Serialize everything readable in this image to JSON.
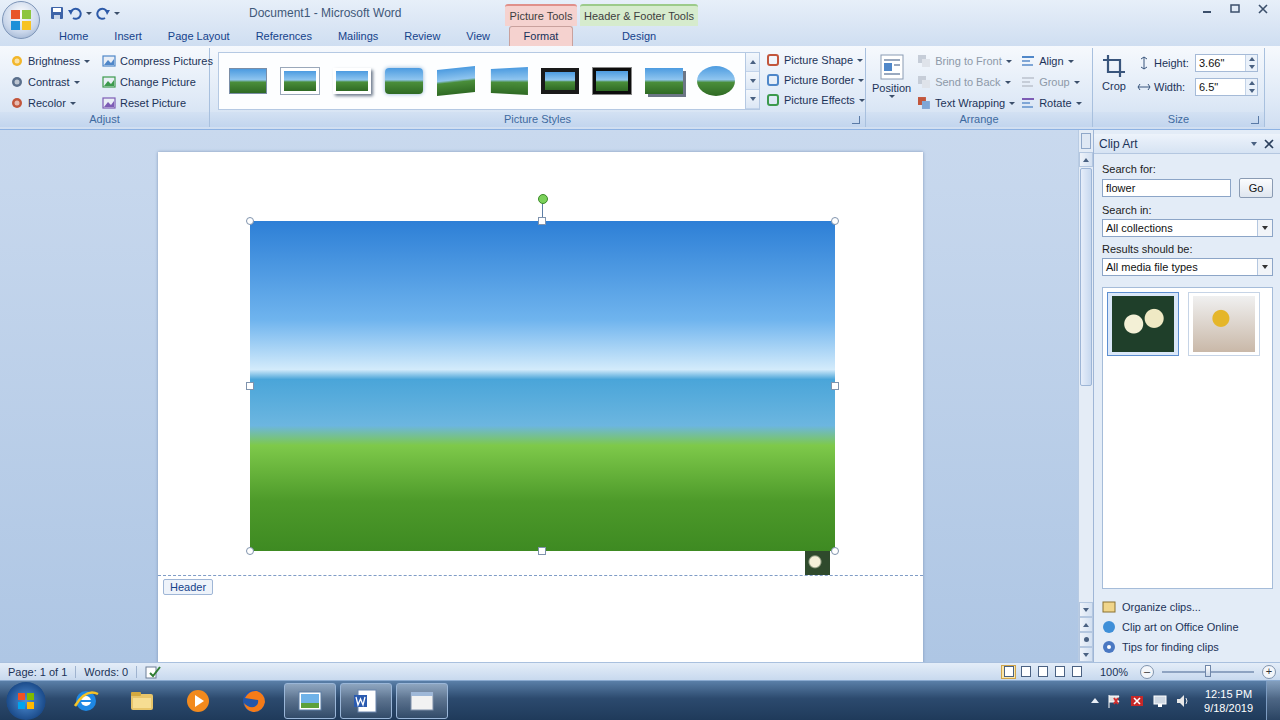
{
  "window": {
    "title": "Document1 - Microsoft Word"
  },
  "tabs": [
    {
      "label": "Home",
      "selected": false
    },
    {
      "label": "Insert",
      "selected": false
    },
    {
      "label": "Page Layout",
      "selected": false
    },
    {
      "label": "References",
      "selected": false
    },
    {
      "label": "Mailings",
      "selected": false
    },
    {
      "label": "Review",
      "selected": false
    },
    {
      "label": "View",
      "selected": false
    }
  ],
  "contextual_tabs": [
    {
      "label": "Picture Tools",
      "color": "#f5d2cf",
      "tabs": [
        {
          "label": "Format",
          "selected": true
        }
      ]
    },
    {
      "label": "Header & Footer Tools",
      "color": "#d6ebcd",
      "tabs": [
        {
          "label": "Design",
          "selected": false
        }
      ]
    }
  ],
  "ribbon": {
    "adjust": {
      "label": "Adjust",
      "left": [
        {
          "label": "Brightness",
          "dropdown": true
        },
        {
          "label": "Contrast",
          "dropdown": true
        },
        {
          "label": "Recolor",
          "dropdown": true
        }
      ],
      "right": [
        {
          "label": "Compress Pictures",
          "dropdown": false
        },
        {
          "label": "Change Picture",
          "dropdown": false
        },
        {
          "label": "Reset Picture",
          "dropdown": false
        }
      ]
    },
    "picture_styles": {
      "label": "Picture Styles",
      "commands": [
        {
          "label": "Picture Shape",
          "dropdown": true
        },
        {
          "label": "Picture Border",
          "dropdown": true
        },
        {
          "label": "Picture Effects",
          "dropdown": true
        }
      ]
    },
    "arrange": {
      "label": "Arrange",
      "position": {
        "label": "Position",
        "dropdown": true
      },
      "commands": [
        {
          "label": "Bring to Front",
          "dropdown": true,
          "disabled": true
        },
        {
          "label": "Send to Back",
          "dropdown": true,
          "disabled": true
        },
        {
          "label": "Text Wrapping",
          "dropdown": true,
          "disabled": false
        },
        {
          "label": "Align",
          "dropdown": true,
          "disabled": false
        },
        {
          "label": "Group",
          "dropdown": true,
          "disabled": true
        },
        {
          "label": "Rotate",
          "dropdown": true,
          "disabled": false
        }
      ]
    },
    "size": {
      "label": "Size",
      "crop": "Crop",
      "fields": [
        {
          "label": "Height:",
          "value": "3.66\""
        },
        {
          "label": "Width:",
          "value": "6.5\""
        }
      ]
    }
  },
  "document": {
    "header_label": "Header"
  },
  "clip_art": {
    "title": "Clip Art",
    "search_label": "Search for:",
    "search_value": "flower",
    "go": "Go",
    "search_in_label": "Search in:",
    "search_in_value": "All collections",
    "results_label": "Results should be:",
    "results_value": "All media file types",
    "results": [
      {
        "selected": true
      },
      {
        "selected": false
      }
    ],
    "links": [
      "Organize clips...",
      "Clip art on Office Online",
      "Tips for finding clips"
    ]
  },
  "status_bar": {
    "page": "Page: 1 of 1",
    "words": "Words: 0",
    "views": [
      {
        "selected": true
      },
      {
        "selected": false
      },
      {
        "selected": false
      },
      {
        "selected": false
      },
      {
        "selected": false
      }
    ],
    "zoom": "100%",
    "zoom_level": 0.5
  },
  "taskbar": {
    "apps": [
      {
        "kind": "ie",
        "running": false
      },
      {
        "kind": "explorer",
        "running": false
      },
      {
        "kind": "media",
        "running": false
      },
      {
        "kind": "firefox",
        "running": false
      },
      {
        "kind": "photo",
        "running": true
      },
      {
        "kind": "word",
        "running": true
      },
      {
        "kind": "window",
        "running": true
      }
    ],
    "time": "12:15 PM",
    "date": "9/18/2019"
  }
}
